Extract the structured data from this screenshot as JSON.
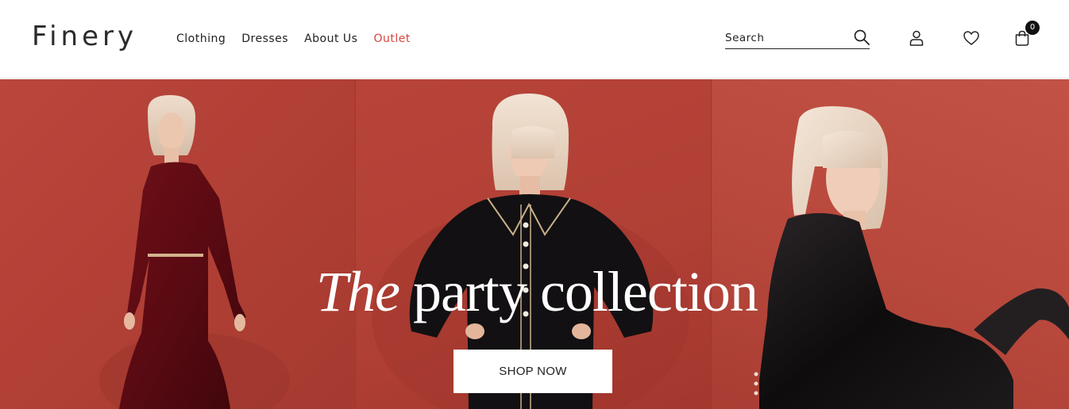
{
  "brand": {
    "logo_text": "Finery"
  },
  "nav": {
    "items": [
      {
        "label": "Clothing"
      },
      {
        "label": "Dresses"
      },
      {
        "label": "About Us"
      },
      {
        "label": "Outlet",
        "highlight_color": "#d9443f"
      }
    ]
  },
  "search": {
    "placeholder": "Search",
    "icon": "search-icon"
  },
  "header_icons": {
    "account": "user-icon",
    "wishlist": "heart-icon",
    "bag": "shopping-bag-icon"
  },
  "cart": {
    "count": "0"
  },
  "hero": {
    "headline_italic": "The",
    "headline_rest": "party collection",
    "cta_label": "SHOP NOW",
    "background_color": "#b8463b"
  }
}
